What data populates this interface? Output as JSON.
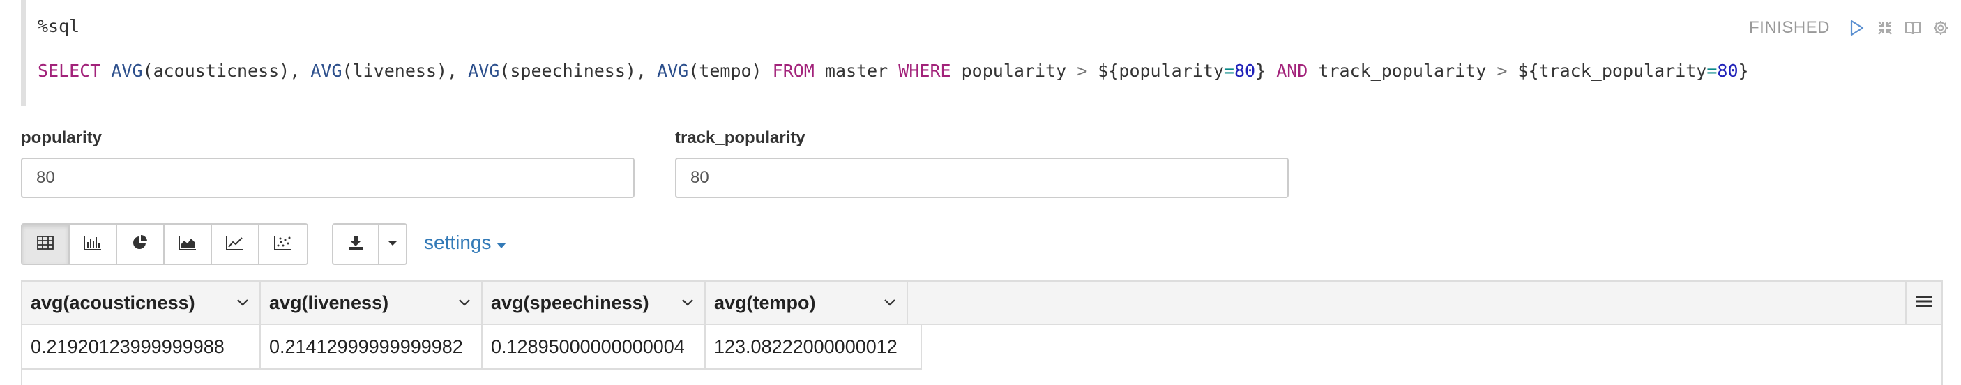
{
  "editor": {
    "magic": "%sql",
    "query": {
      "select": "SELECT",
      "avg": "AVG",
      "col_acousticness": "(acousticness), ",
      "col_liveness": "(liveness), ",
      "col_speechiness": "(speechiness), ",
      "col_tempo": "(tempo) ",
      "from": "FROM",
      "table": " master ",
      "where": "WHERE",
      "p1_name": " popularity ",
      "gt": ">",
      "p1_open": " ${popularity",
      "eq": "=",
      "p1_val": "80",
      "close": "}",
      "and": " AND",
      "p2_name": " track_popularity ",
      "p2_open": " ${track_popularity",
      "p2_val": "80"
    }
  },
  "status": {
    "text": "FINISHED",
    "icons": [
      "run-icon",
      "collapse-icon",
      "book-icon",
      "gear-icon"
    ]
  },
  "params": {
    "popularity": {
      "label": "popularity",
      "value": "80"
    },
    "track_popularity": {
      "label": "track_popularity",
      "value": "80"
    }
  },
  "toolbar": {
    "viz_buttons": [
      "table-icon",
      "bar-chart-icon",
      "pie-chart-icon",
      "area-chart-icon",
      "line-chart-icon",
      "scatter-chart-icon"
    ],
    "settings_label": "settings"
  },
  "table": {
    "columns": [
      "avg(acousticness)",
      "avg(liveness)",
      "avg(speechiness)",
      "avg(tempo)"
    ],
    "rows": [
      [
        "0.21920123999999988",
        "0.21412999999999982",
        "0.12895000000000004",
        "123.08222000000012"
      ]
    ]
  },
  "colors": {
    "keyword": "#a2227a",
    "function": "#2c4f8c",
    "number": "#1e20b8",
    "link": "#337ab7",
    "status": "#999999"
  }
}
